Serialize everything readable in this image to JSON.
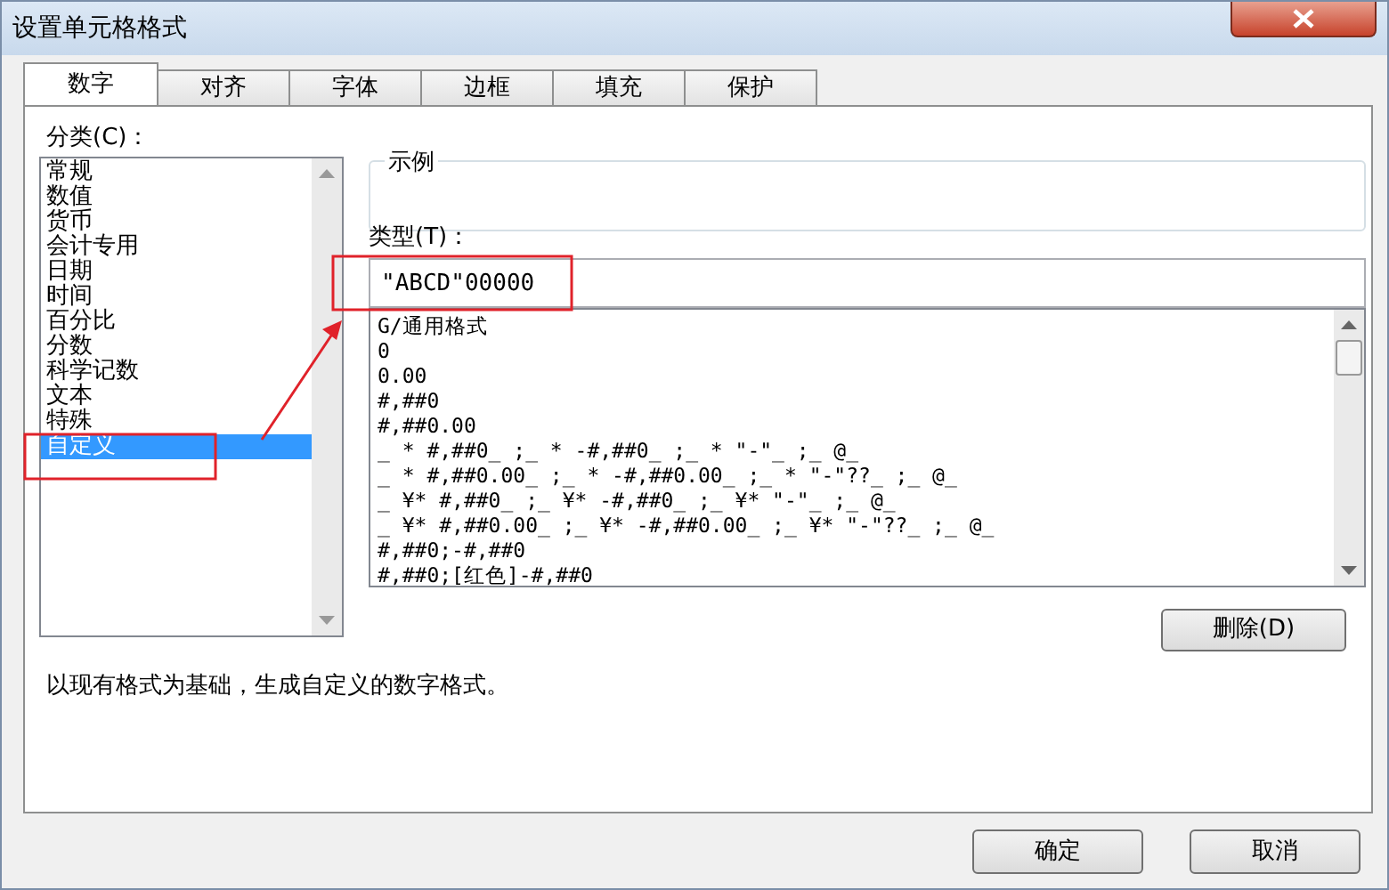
{
  "window": {
    "title": "设置单元格格式"
  },
  "tabs": [
    {
      "label": "数字",
      "selected": true
    },
    {
      "label": "对齐",
      "selected": false
    },
    {
      "label": "字体",
      "selected": false
    },
    {
      "label": "边框",
      "selected": false
    },
    {
      "label": "填充",
      "selected": false
    },
    {
      "label": "保护",
      "selected": false
    }
  ],
  "category": {
    "label": "分类(C)：",
    "items": [
      {
        "label": "常规",
        "selected": false
      },
      {
        "label": "数值",
        "selected": false
      },
      {
        "label": "货币",
        "selected": false
      },
      {
        "label": "会计专用",
        "selected": false
      },
      {
        "label": "日期",
        "selected": false
      },
      {
        "label": "时间",
        "selected": false
      },
      {
        "label": "百分比",
        "selected": false
      },
      {
        "label": "分数",
        "selected": false
      },
      {
        "label": "科学记数",
        "selected": false
      },
      {
        "label": "文本",
        "selected": false
      },
      {
        "label": "特殊",
        "selected": false
      },
      {
        "label": "自定义",
        "selected": true
      }
    ]
  },
  "sample": {
    "label": "示例"
  },
  "type": {
    "label": "类型(T)：",
    "value": "\"ABCD\"00000"
  },
  "formats": [
    "G/通用格式",
    "0",
    "0.00",
    "#,##0",
    "#,##0.00",
    "_ * #,##0_ ;_ * -#,##0_ ;_ * \"-\"_ ;_ @_",
    "_ * #,##0.00_ ;_ * -#,##0.00_ ;_ * \"-\"??_ ;_ @_",
    "_ ¥* #,##0_ ;_ ¥* -#,##0_ ;_ ¥* \"-\"_ ;_ @_",
    "_ ¥* #,##0.00_ ;_ ¥* -#,##0.00_ ;_ ¥* \"-\"??_ ;_ @_",
    "#,##0;-#,##0",
    "#,##0;[红色]-#,##0"
  ],
  "delete_button": "删除(D)",
  "description": "以现有格式为基础，生成自定义的数字格式。",
  "buttons": [
    "确定",
    "取消"
  ]
}
